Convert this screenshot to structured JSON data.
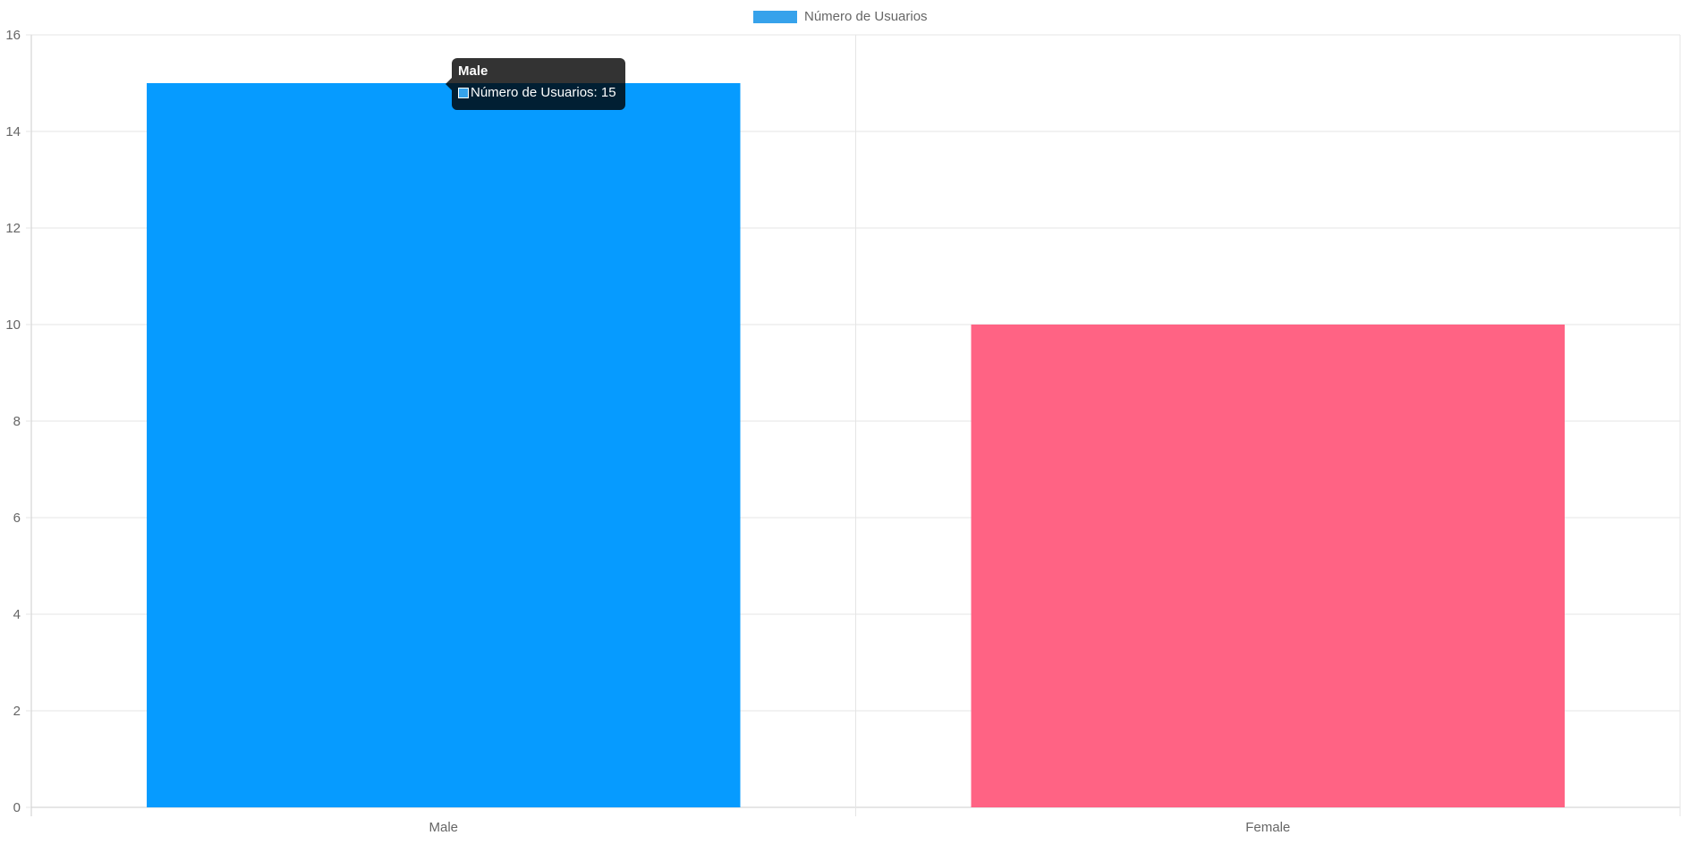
{
  "chart_data": {
    "type": "bar",
    "categories": [
      "Male",
      "Female"
    ],
    "series": [
      {
        "name": "Número de Usuarios",
        "values": [
          15,
          10
        ],
        "colors": [
          "#069BFF",
          "#FF6384"
        ]
      }
    ],
    "ylim": [
      0,
      16
    ],
    "yticks": [
      "0",
      "2",
      "4",
      "6",
      "8",
      "10",
      "12",
      "14",
      "16"
    ],
    "grid": true,
    "legend": {
      "position": "top",
      "label": "Número de Usuarios",
      "color": "#36A2EB"
    }
  },
  "tooltip": {
    "title": "Male",
    "body": "Número de Usuarios: 15",
    "swatch_color": "#36A2EB"
  },
  "colors": {
    "grid": "#e5e5e5",
    "axis": "#cccccc",
    "tick_text": "#666666"
  }
}
